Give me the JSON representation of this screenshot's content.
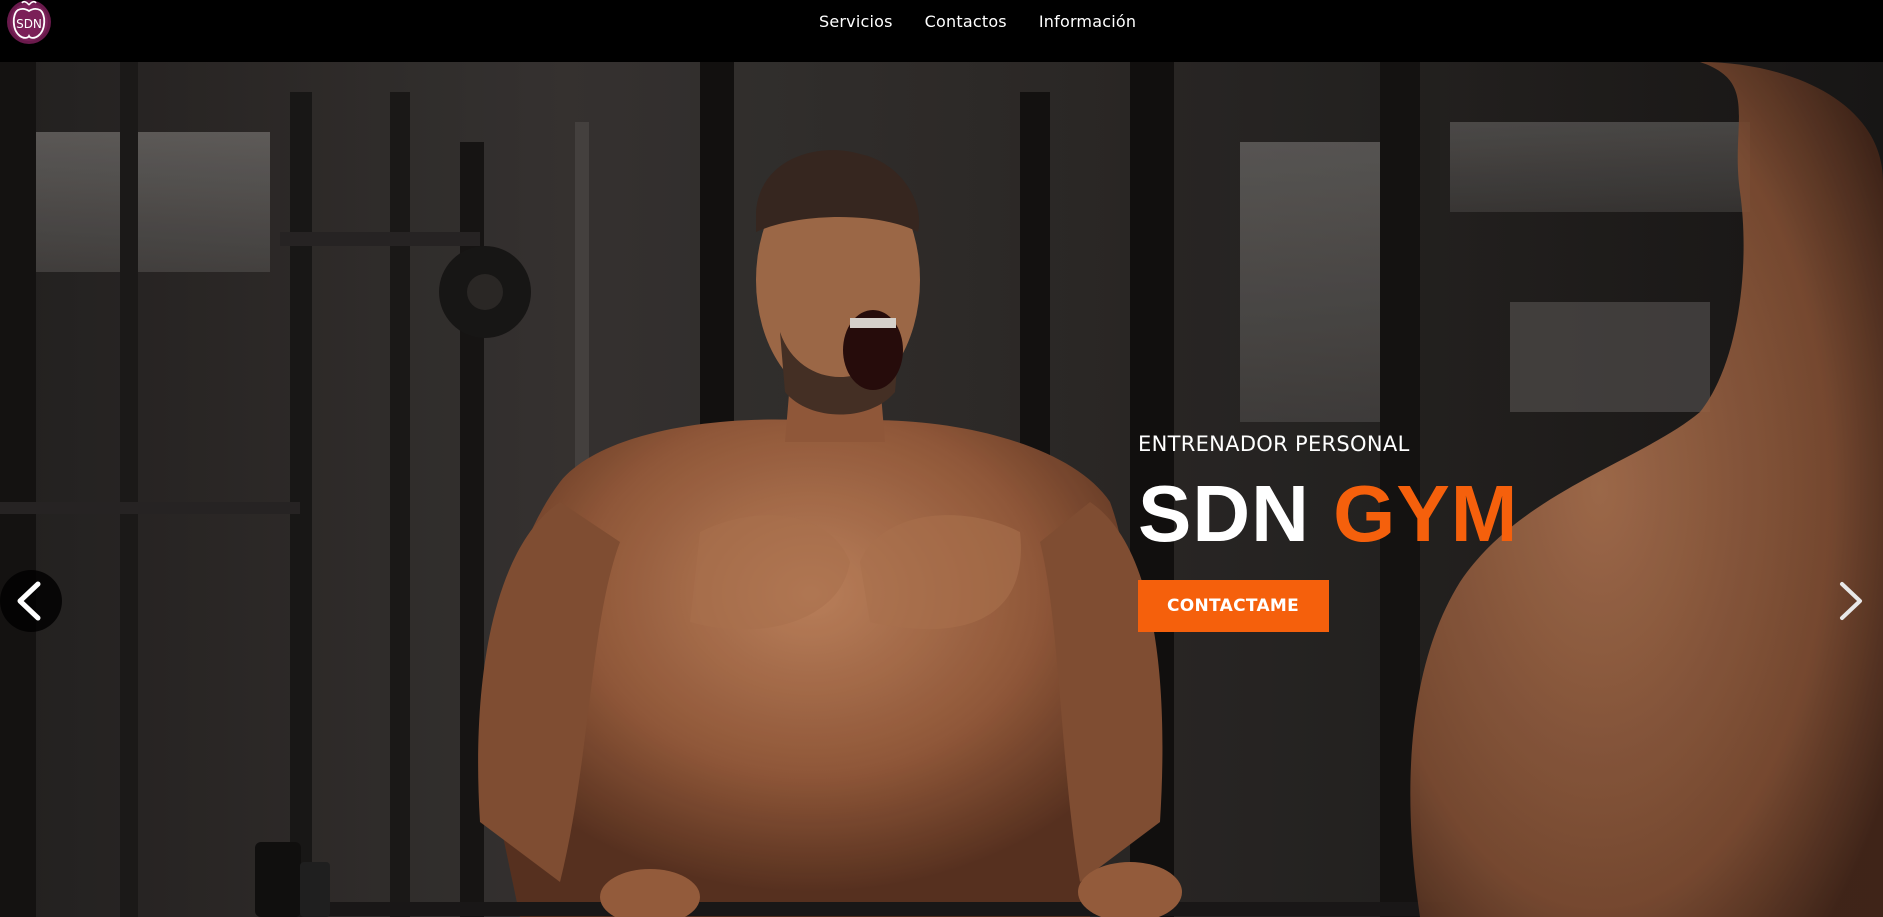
{
  "nav": {
    "logo_text": "SDN",
    "links": [
      {
        "label": "Servicios"
      },
      {
        "label": "Contactos"
      },
      {
        "label": "Información"
      }
    ]
  },
  "hero": {
    "subtitle": "ENTRENADOR PERSONAL",
    "title_part1": "SDN",
    "title_part2": "GYM",
    "cta_label": "CONTACTAME",
    "background_image": "Man shouting while lifting barbell in gym",
    "accent_color": "#f5600c"
  },
  "carousel": {
    "prev_icon": "chevron-left-icon",
    "next_icon": "chevron-right-icon"
  }
}
